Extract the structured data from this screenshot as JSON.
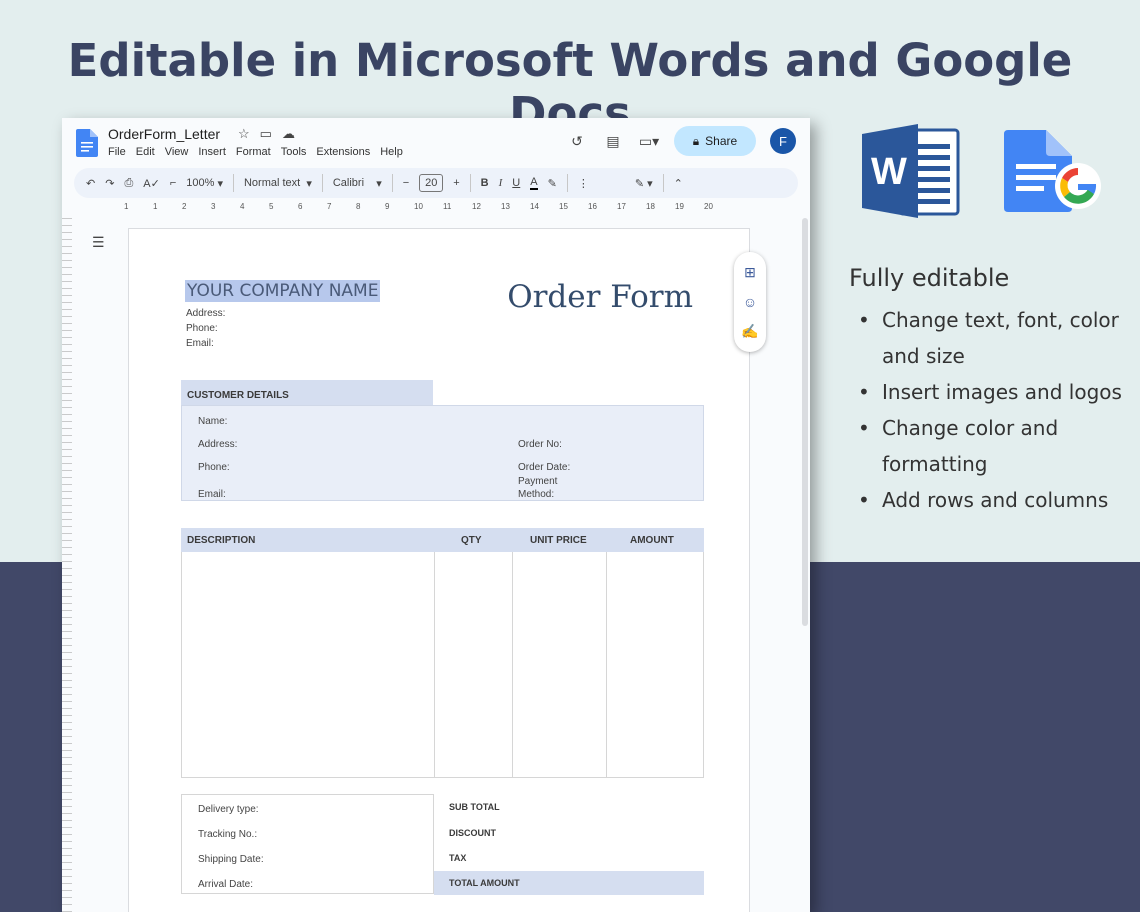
{
  "headline": "Editable in Microsoft Words and Google Docs",
  "docs": {
    "title": "OrderForm_Letter",
    "menu": [
      "File",
      "Edit",
      "View",
      "Insert",
      "Format",
      "Tools",
      "Extensions",
      "Help"
    ],
    "share_label": "Share",
    "avatar_initial": "F",
    "toolbar": {
      "zoom": "100%",
      "style": "Normal text",
      "font": "Calibri",
      "font_size": "20",
      "bold": "B",
      "italic": "I",
      "underline": "U",
      "text_color": "A"
    },
    "ruler": [
      "1",
      "1",
      "2",
      "3",
      "4",
      "5",
      "6",
      "7",
      "8",
      "9",
      "10",
      "11",
      "12",
      "13",
      "14",
      "15",
      "16",
      "17",
      "18",
      "19",
      "20"
    ]
  },
  "form": {
    "company_name": "YOUR COMPANY NAME",
    "address_label": "Address:",
    "phone_label": "Phone:",
    "email_label": "Email:",
    "title": "Order Form",
    "customer_header": "CUSTOMER DETAILS",
    "customer": {
      "name": "Name:",
      "address": "Address:",
      "phone": "Phone:",
      "email": "Email:",
      "order_no": "Order No:",
      "order_date": "Order Date:",
      "payment": "Payment",
      "method": "Method:"
    },
    "columns": [
      "DESCRIPTION",
      "QTY",
      "UNIT PRICE",
      "AMOUNT"
    ],
    "shipping": [
      "Delivery type:",
      "Tracking No.:",
      "Shipping Date:",
      "Arrival Date:"
    ],
    "totals": [
      "SUB TOTAL",
      "DISCOUNT",
      "TAX",
      "TOTAL AMOUNT"
    ]
  },
  "features": {
    "title": "Fully editable",
    "items": [
      "Change text, font, color and size",
      "Insert images and logos",
      "Change color and formatting",
      "Add rows and columns"
    ]
  },
  "colors": {
    "bg_top": "#e3eeee",
    "bg_bottom": "#414868",
    "headline": "#3a4463",
    "table_header": "#d5def0"
  }
}
